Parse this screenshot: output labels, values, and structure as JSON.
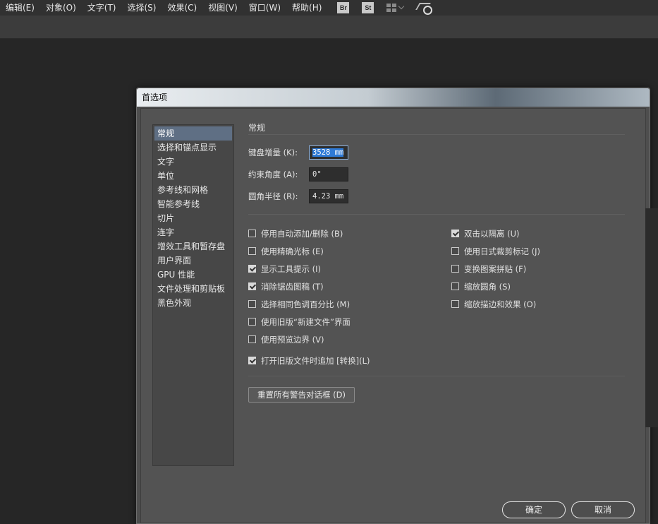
{
  "menubar": {
    "items": [
      "编辑(E)",
      "对象(O)",
      "文字(T)",
      "选择(S)",
      "效果(C)",
      "视图(V)",
      "窗口(W)",
      "帮助(H)"
    ],
    "bridge_label": "Br",
    "stock_label": "St"
  },
  "dialog": {
    "title": "首选项",
    "sidebar": [
      "常规",
      "选择和锚点显示",
      "文字",
      "单位",
      "参考线和网格",
      "智能参考线",
      "切片",
      "连字",
      "增效工具和暂存盘",
      "用户界面",
      "GPU 性能",
      "文件处理和剪贴板",
      "黑色外观"
    ],
    "section_title": "常规",
    "fields": {
      "keyboard_increment": {
        "label": "键盘增量 (K):",
        "value": "3528 mm"
      },
      "constrain_angle": {
        "label": "约束角度 (A):",
        "value": "0°"
      },
      "corner_radius": {
        "label": "圆角半径 (R):",
        "value": "4.23 mm"
      }
    },
    "checkboxes_left": [
      {
        "label": "停用自动添加/删除 (B)",
        "checked": false
      },
      {
        "label": "使用精确光标 (E)",
        "checked": false
      },
      {
        "label": "显示工具提示 (I)",
        "checked": true
      },
      {
        "label": "消除锯齿图稿 (T)",
        "checked": true
      },
      {
        "label": "选择相同色调百分比 (M)",
        "checked": false
      },
      {
        "label": "使用旧版“新建文件”界面",
        "checked": false
      },
      {
        "label": "使用预览边界 (V)",
        "checked": false
      },
      {
        "label": "打开旧版文件时追加 [转换](L)",
        "checked": true
      }
    ],
    "checkboxes_right": [
      {
        "label": "双击以隔离 (U)",
        "checked": true
      },
      {
        "label": "使用日式裁剪标记 (J)",
        "checked": false
      },
      {
        "label": "变换图案拼贴 (F)",
        "checked": false
      },
      {
        "label": "缩放圆角 (S)",
        "checked": false
      },
      {
        "label": "缩放描边和效果 (O)",
        "checked": false
      }
    ],
    "reset_button": "重置所有警告对话框 (D)",
    "ok_button": "确定",
    "cancel_button": "取消"
  }
}
